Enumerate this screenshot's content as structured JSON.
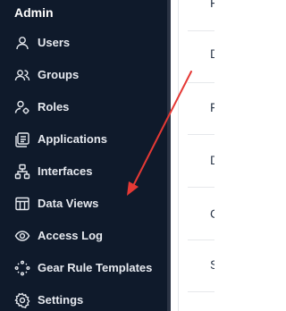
{
  "sidebar": {
    "section_title": "Admin",
    "items": [
      {
        "label": "Users",
        "icon": "user-icon"
      },
      {
        "label": "Groups",
        "icon": "users-group-icon"
      },
      {
        "label": "Roles",
        "icon": "user-role-icon"
      },
      {
        "label": "Applications",
        "icon": "applications-icon"
      },
      {
        "label": "Interfaces",
        "icon": "interfaces-icon"
      },
      {
        "label": "Data Views",
        "icon": "table-icon"
      },
      {
        "label": "Access Log",
        "icon": "eye-icon"
      },
      {
        "label": "Gear Rule Templates",
        "icon": "rule-templates-icon"
      },
      {
        "label": "Settings",
        "icon": "gear-icon"
      }
    ]
  },
  "content": {
    "row_letters": [
      "F",
      "D",
      "F",
      "D",
      "C",
      "S"
    ]
  },
  "colors": {
    "sidebar_bg": "#0f1a2b",
    "text": "#e6e9ef",
    "annotation_arrow": "#e53935"
  }
}
